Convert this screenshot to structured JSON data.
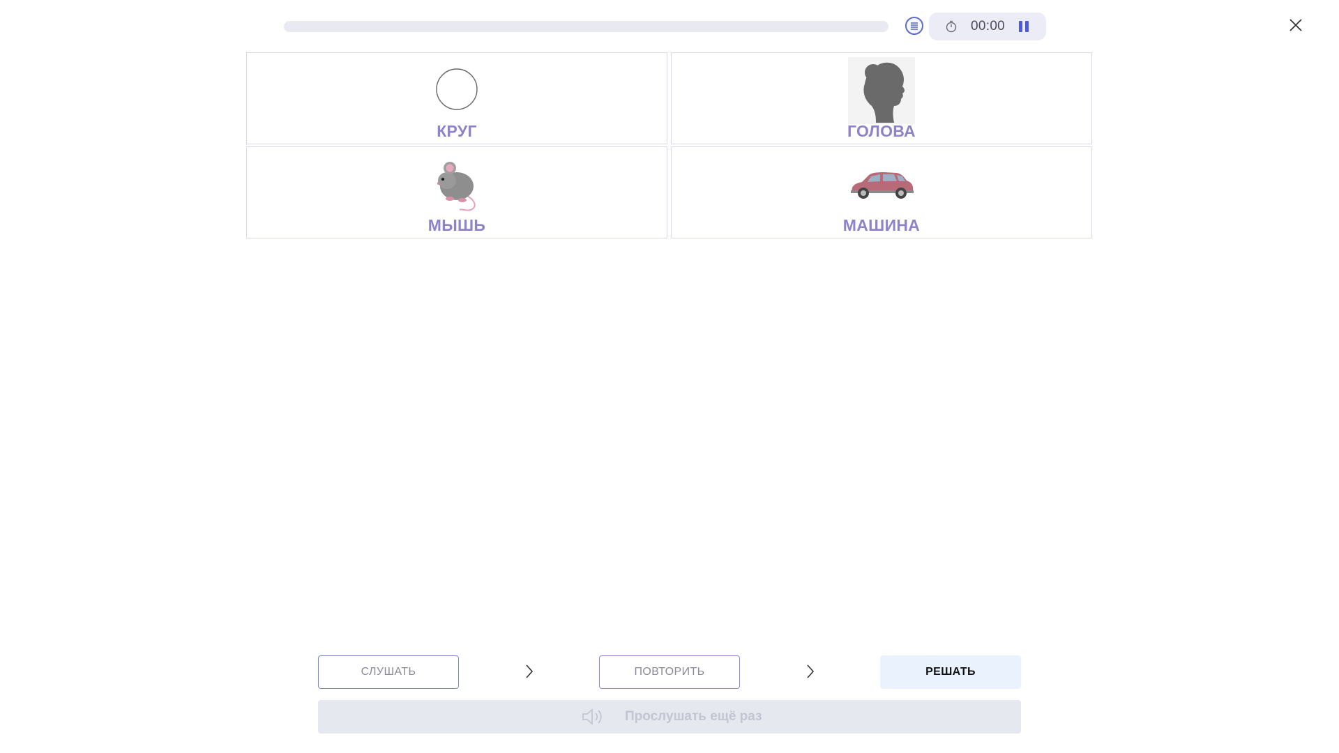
{
  "header": {
    "progress_fraction": 0,
    "timer": "00:00"
  },
  "cards": [
    {
      "label": "КРУГ",
      "icon": "circle-picture"
    },
    {
      "label": "ГОЛОВА",
      "icon": "head-silhouette-picture"
    },
    {
      "label": "МЫШЬ",
      "icon": "mouse-picture"
    },
    {
      "label": "МАШИНА",
      "icon": "car-picture"
    }
  ],
  "controls": {
    "listen_label": "СЛУШАТЬ",
    "repeat_label": "ПОВТОРИТЬ",
    "solve_label": "РЕШАТЬ",
    "listen_again_label": "Прослушать ещё раз"
  },
  "colors": {
    "accent": "#5c6cc8",
    "label": "#8d83c8",
    "solve_bg": "#eaf2fe"
  }
}
